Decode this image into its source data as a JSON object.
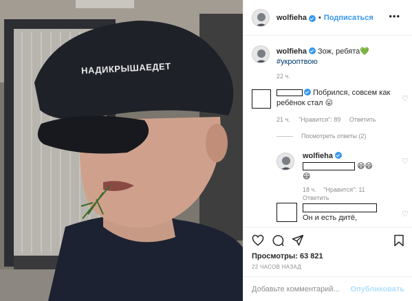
{
  "post": {
    "username": "wolfieha",
    "follow_label": "Подписаться",
    "cap_text": "НАДИКРЫШАЕДЕТ"
  },
  "caption": {
    "username": "wolfieha",
    "text": "Зож, ребята",
    "emoji": "💚",
    "hashtag": "#укроптвою",
    "time": "22 ч."
  },
  "comments": [
    {
      "text": "Побрился, совсем как ребёнок стал",
      "emoji": "😛",
      "time": "21 ч.",
      "likes": "\"Нравится\": 89",
      "reply_label": "Ответить"
    }
  ],
  "view_replies": "Посмотреть ответы (2)",
  "replies": [
    {
      "username": "wolfieha",
      "emoji_a": "😄😄",
      "emoji_b": "😄",
      "time": "18 ч.",
      "likes": "\"Нравится\": 11",
      "reply_label": "Ответить"
    },
    {
      "text": "Он и есть дитё,"
    }
  ],
  "stats": {
    "views": "Просмотры: 63 821",
    "time_ago": "22 ЧАСОВ НАЗАД"
  },
  "add_comment": {
    "placeholder": "Добавьте комментарий...",
    "publish_label": "Опубликовать"
  },
  "colors": {
    "accent": "#3897f0",
    "meta": "#8e8e8e",
    "publish_disabled": "#b2dffc",
    "verified": "#3897f0"
  },
  "icons": [
    "more-icon",
    "verified-icon",
    "heart-icon",
    "comment-icon",
    "share-icon",
    "bookmark-icon",
    "like-icon"
  ]
}
